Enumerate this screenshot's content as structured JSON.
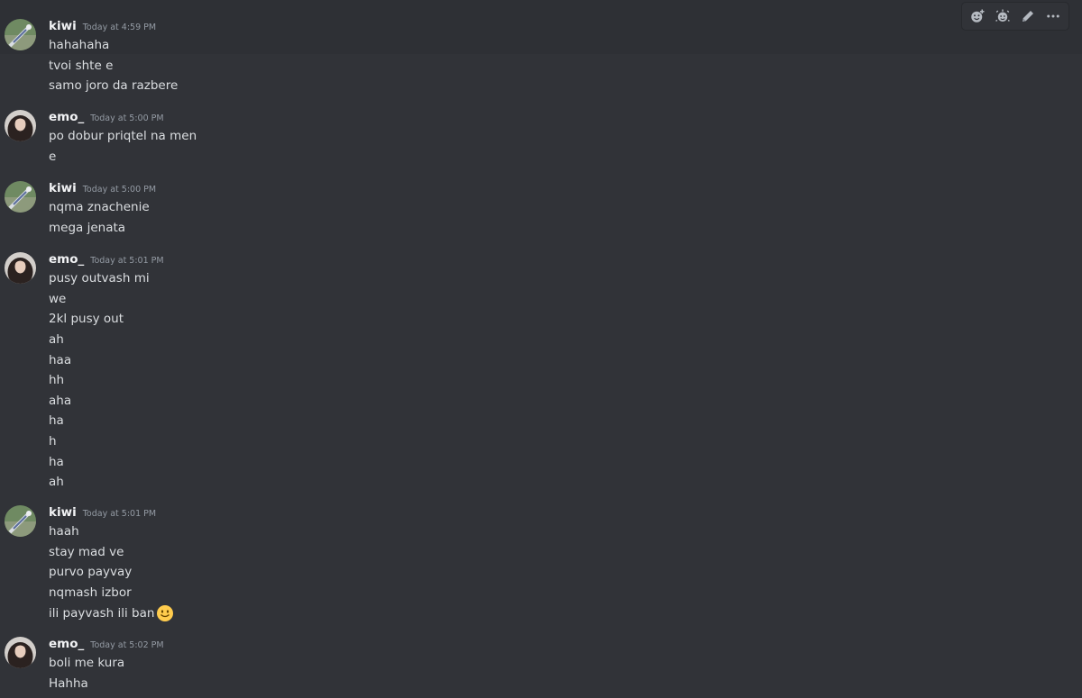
{
  "toolbar": {
    "icons": [
      "add-reaction-icon",
      "super-reaction-icon",
      "edit-icon",
      "more-options-icon"
    ]
  },
  "messages": [
    {
      "user": "kiwi",
      "time": "Today at 4:59 PM",
      "lines": [
        "hahahaha",
        "tvoi shte e",
        "samo joro da razbere"
      ]
    },
    {
      "user": "emo_",
      "time": "Today at 5:00 PM",
      "lines": [
        "po dobur priqtel na men",
        "e"
      ]
    },
    {
      "user": "kiwi",
      "time": "Today at 5:00 PM",
      "lines": [
        "nqma znachenie",
        "mega jenata"
      ]
    },
    {
      "user": "emo_",
      "time": "Today at 5:01 PM",
      "lines": [
        "pusy outvash mi",
        "we",
        "2kl pusy out",
        "ah",
        "haa",
        "hh",
        "aha",
        "ha",
        "h",
        "ha",
        "ah"
      ]
    },
    {
      "user": "kiwi",
      "time": "Today at 5:01 PM",
      "lines": [
        "haah",
        "stay mad ve",
        "purvo payvay",
        "nqmash izbor",
        "ili payvash ili ban"
      ],
      "emoji_last_line": "slightly-smiling-face-emoji"
    },
    {
      "user": "emo_",
      "time": "Today at 5:02 PM",
      "lines": [
        "boli me kura",
        "Hahha"
      ]
    }
  ]
}
